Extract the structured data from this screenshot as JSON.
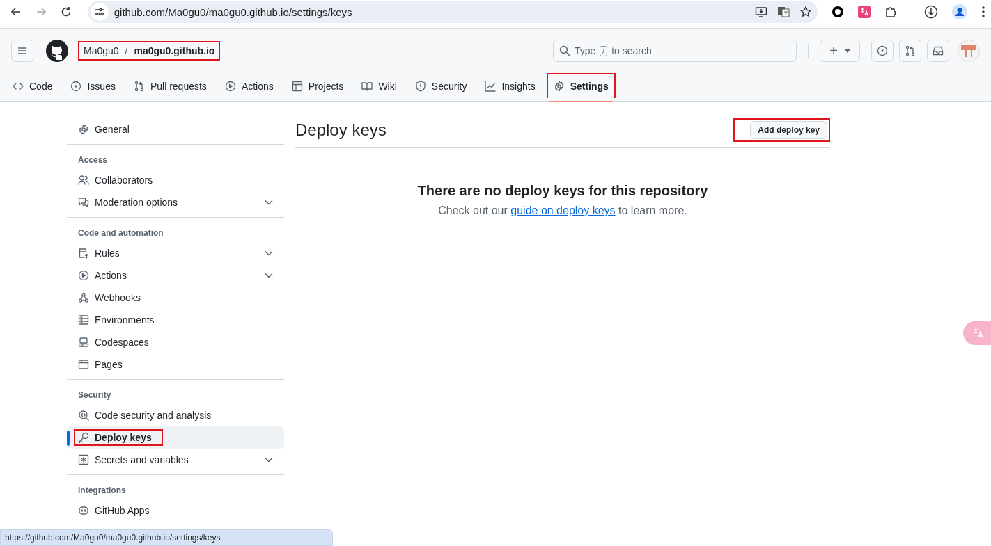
{
  "browser": {
    "url": "github.com/Ma0gu0/ma0gu0.github.io/settings/keys",
    "forward_disabled": true
  },
  "header": {
    "owner": "Ma0gu0",
    "separator": "/",
    "repo": "ma0gu0.github.io",
    "breadcrumb_highlighted": true,
    "search": {
      "placeholder_before": "Type",
      "key": "/",
      "placeholder_after": "to search"
    },
    "new_button": "+"
  },
  "tabs": [
    {
      "label": "Code",
      "selected": false,
      "highlighted": false
    },
    {
      "label": "Issues",
      "selected": false,
      "highlighted": false
    },
    {
      "label": "Pull requests",
      "selected": false,
      "highlighted": false
    },
    {
      "label": "Actions",
      "selected": false,
      "highlighted": false
    },
    {
      "label": "Projects",
      "selected": false,
      "highlighted": false
    },
    {
      "label": "Wiki",
      "selected": false,
      "highlighted": false
    },
    {
      "label": "Security",
      "selected": false,
      "highlighted": false
    },
    {
      "label": "Insights",
      "selected": false,
      "highlighted": false
    },
    {
      "label": "Settings",
      "selected": true,
      "highlighted": true
    }
  ],
  "sidebar": {
    "sections": [
      {
        "items": [
          {
            "label": "General",
            "selected": false,
            "expandable": false,
            "highlighted": false
          }
        ]
      },
      {
        "heading": "Access",
        "items": [
          {
            "label": "Collaborators",
            "selected": false,
            "expandable": false,
            "highlighted": false
          },
          {
            "label": "Moderation options",
            "selected": false,
            "expandable": true,
            "highlighted": false
          }
        ]
      },
      {
        "heading": "Code and automation",
        "items": [
          {
            "label": "Rules",
            "selected": false,
            "expandable": true,
            "highlighted": false
          },
          {
            "label": "Actions",
            "selected": false,
            "expandable": true,
            "highlighted": false
          },
          {
            "label": "Webhooks",
            "selected": false,
            "expandable": false,
            "highlighted": false
          },
          {
            "label": "Environments",
            "selected": false,
            "expandable": false,
            "highlighted": false
          },
          {
            "label": "Codespaces",
            "selected": false,
            "expandable": false,
            "highlighted": false
          },
          {
            "label": "Pages",
            "selected": false,
            "expandable": false,
            "highlighted": false
          }
        ]
      },
      {
        "heading": "Security",
        "items": [
          {
            "label": "Code security and analysis",
            "selected": false,
            "expandable": false,
            "highlighted": false
          },
          {
            "label": "Deploy keys",
            "selected": true,
            "expandable": false,
            "highlighted": true
          },
          {
            "label": "Secrets and variables",
            "selected": false,
            "expandable": true,
            "highlighted": false
          }
        ]
      },
      {
        "heading": "Integrations",
        "items": [
          {
            "label": "GitHub Apps",
            "selected": false,
            "expandable": false,
            "highlighted": false
          }
        ]
      }
    ]
  },
  "main": {
    "title": "Deploy keys",
    "add_button": "Add deploy key",
    "add_button_highlighted": true,
    "blank_title": "There are no deploy keys for this repository",
    "blank_before": "Check out our",
    "blank_link": "guide on deploy keys",
    "blank_after": "to learn more."
  },
  "status_url": "https://github.com/Ma0gu0/ma0gu0.github.io/settings/keys"
}
